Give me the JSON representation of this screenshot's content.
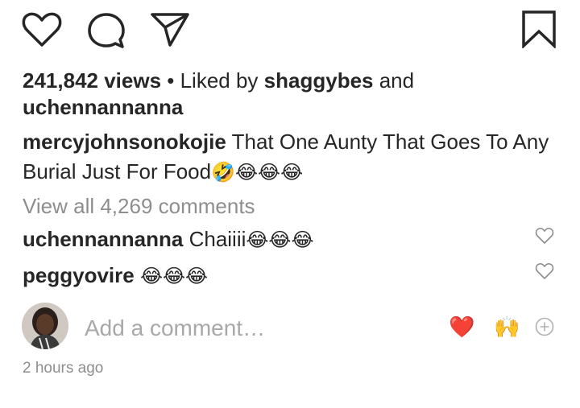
{
  "actions": {
    "like_icon": "heart-icon",
    "comment_icon": "comment-icon",
    "share_icon": "send-icon",
    "save_icon": "bookmark-icon"
  },
  "stats": {
    "views": "241,842 views",
    "separator": " • Liked by ",
    "liked_by_user": "shaggybes",
    "conjunction": " and",
    "liked_by_other": "uchennannanna"
  },
  "caption": {
    "username": "mercyjohnsonokojie",
    "text": " That One Aunty That Goes To Any Burial Just For Food",
    "emojis": "🤣😂😂😂"
  },
  "view_all_comments": "View all 4,269 comments",
  "comments": [
    {
      "username": "uchennannanna",
      "text": " Chaiiii",
      "emojis": "😂😂😂"
    },
    {
      "username": "peggyovire",
      "text": " ",
      "emojis": "😂😂😂"
    }
  ],
  "add_comment": {
    "placeholder": "Add a comment…",
    "quick_reactions": [
      "❤️",
      "🙌"
    ],
    "add_icon": "plus-circle-icon"
  },
  "timestamp": "2 hours ago",
  "colors": {
    "heart_red": "#ed4956",
    "muted": "#8e8e8e",
    "text": "#262626"
  }
}
